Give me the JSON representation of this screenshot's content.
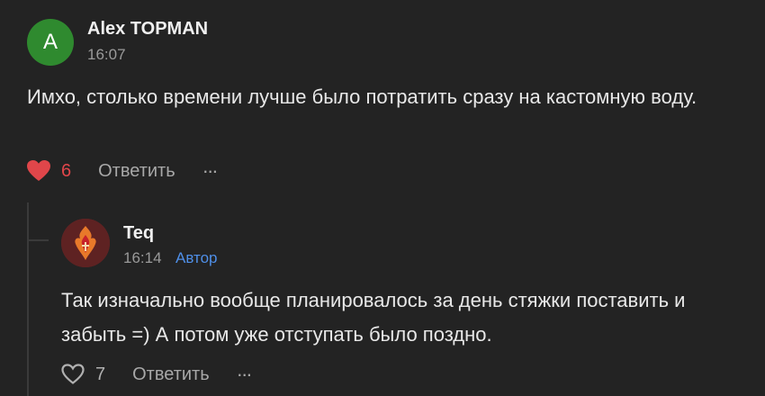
{
  "comment": {
    "avatar_letter": "A",
    "avatar_color": "#2f8a2f",
    "author": "Alex TOPMAN",
    "time": "16:07",
    "text": "Имхо, столько времени лучше было потратить сразу на кастомную воду.",
    "likes": "6",
    "liked": true,
    "like_icon": "heart-filled-icon",
    "reply_label": "Ответить",
    "more_label": "···"
  },
  "reply": {
    "author": "Teq",
    "time": "16:14",
    "badge": "Автор",
    "badge_color": "#4f8fe8",
    "text": "Так изначально вообще планировалось за день стяжки поставить и забыть =) А потом уже отступать было поздно.",
    "likes": "7",
    "liked": false,
    "like_icon": "heart-outline-icon",
    "reply_label": "Ответить",
    "more_label": "···"
  },
  "colors": {
    "background": "#232323",
    "like_active": "#e0464a"
  }
}
